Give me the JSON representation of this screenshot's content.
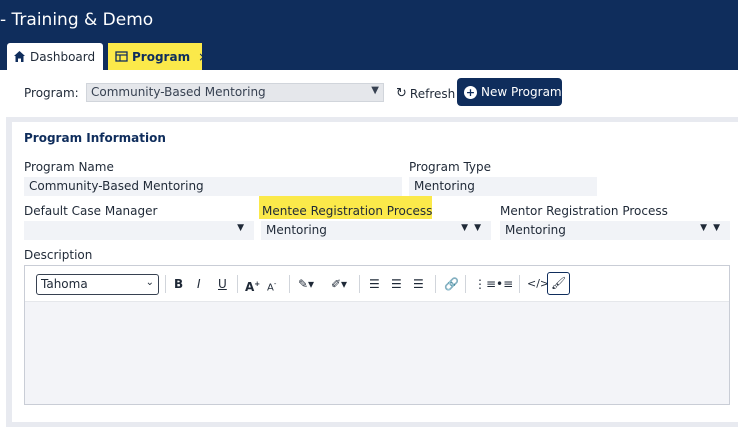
{
  "app": {
    "title": "- Training & Demo"
  },
  "tabs": [
    {
      "label": "Dashboard",
      "icon": "home-icon"
    },
    {
      "label": "Program",
      "icon": "table-icon",
      "close": "×"
    }
  ],
  "toolbar": {
    "program_label": "Program:",
    "program_value": "Community-Based Mentoring",
    "refresh_label": "Refresh",
    "new_program_label": "New Program"
  },
  "section": {
    "title": "Program Information",
    "program_name_label": "Program Name",
    "program_name_value": "Community-Based Mentoring",
    "program_type_label": "Program Type",
    "program_type_value": "Mentoring",
    "case_manager_label": "Default Case Manager",
    "case_manager_value": "",
    "mentee_reg_label": "Mentee Registration Process",
    "mentee_reg_value": "Mentoring",
    "mentor_reg_label": "Mentor Registration Process",
    "mentor_reg_value": "Mentoring",
    "description_label": "Description"
  },
  "editor": {
    "font": "Tahoma",
    "bold": "B",
    "italic": "I",
    "underline": "U"
  },
  "colors": {
    "navy": "#0f2d5c",
    "highlight": "#fbe94a"
  }
}
